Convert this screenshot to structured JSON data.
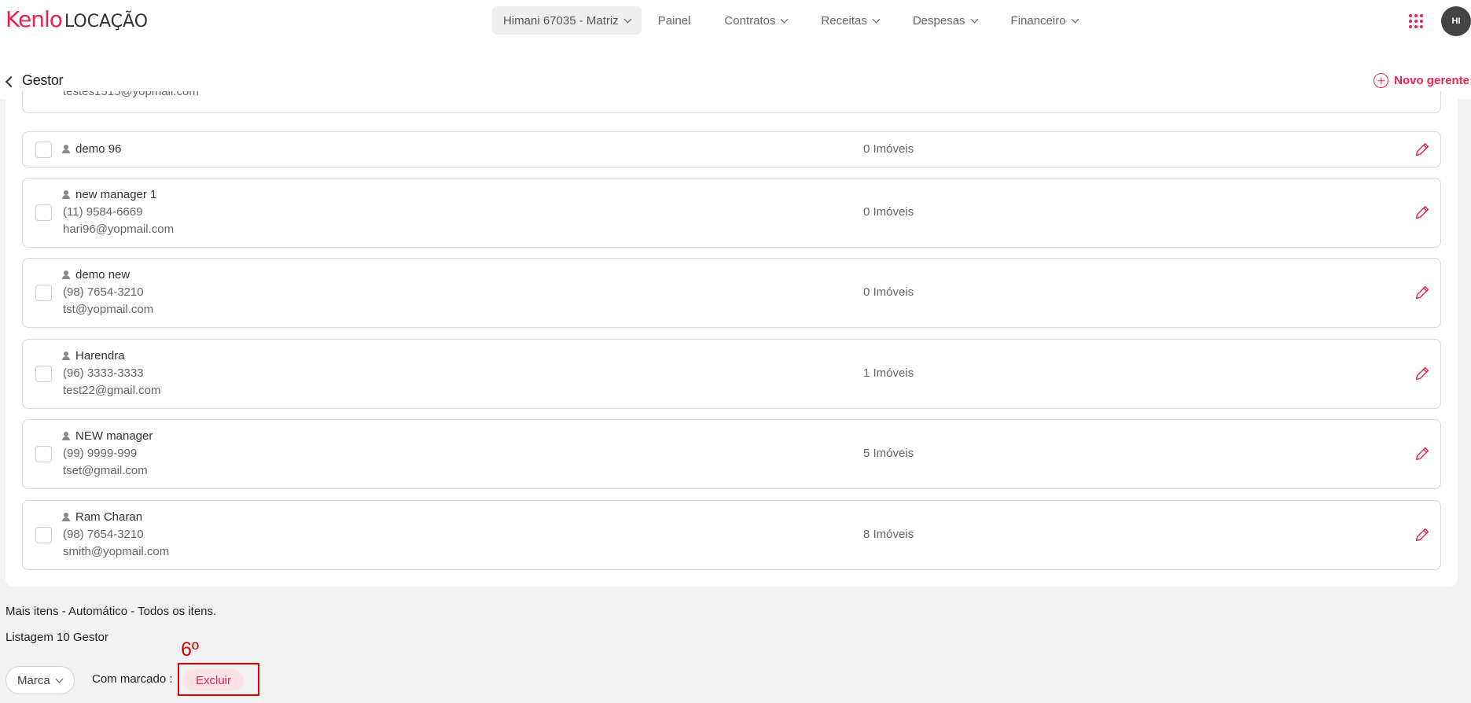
{
  "brand": {
    "name_part1": "Kenlo",
    "name_part2": "LOCAÇÃO",
    "accent": "#e8244f"
  },
  "topnav": {
    "branch": "Himani 67035 - Matriz",
    "items": [
      {
        "label": "Painel",
        "dropdown": false
      },
      {
        "label": "Contratos",
        "dropdown": true
      },
      {
        "label": "Receitas",
        "dropdown": true
      },
      {
        "label": "Despesas",
        "dropdown": true
      },
      {
        "label": "Financeiro",
        "dropdown": true
      }
    ],
    "avatar_initials": "HI"
  },
  "header": {
    "title": "Gestor",
    "new_button": "Novo gerente"
  },
  "partial_row": {
    "email": "testes1515@yopmail.com"
  },
  "managers": [
    {
      "name": "demo 96",
      "phone": "",
      "email": "",
      "properties": "0 Imóveis"
    },
    {
      "name": "new manager 1",
      "phone": "(11) 9584-6669",
      "email": "hari96@yopmail.com",
      "properties": "0 Imóveis"
    },
    {
      "name": "demo new",
      "phone": "(98) 7654-3210",
      "email": "tst@yopmail.com",
      "properties": "0 Imóveis"
    },
    {
      "name": "Harendra",
      "phone": "(96) 3333-3333",
      "email": "test22@gmail.com",
      "properties": "1 Imóveis"
    },
    {
      "name": "NEW manager",
      "phone": "(99) 9999-999",
      "email": "tset@gmail.com",
      "properties": "5 Imóveis"
    },
    {
      "name": "Ram Charan",
      "phone": "(98) 7654-3210",
      "email": "smith@yopmail.com",
      "properties": "8 Imóveis"
    }
  ],
  "footer": {
    "more_items": "Mais itens - Automático - Todos os itens.",
    "listing": "Listagem 10 Gestor",
    "brand_select": "Marca",
    "with_checked": "Com marcado :",
    "delete": "Excluir",
    "annotation": "6º"
  }
}
